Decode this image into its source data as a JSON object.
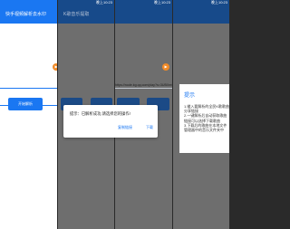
{
  "panel1": {
    "title": "快手视频解析去水印",
    "fab_label": "▶",
    "action_button": "开始解析"
  },
  "panel2": {
    "time": "晚上10:23",
    "title": "K歌音乐提取"
  },
  "panel3": {
    "time": "晚上10:23",
    "url": "https://node.kg.qq.com/play?s=3UBXmOTTFTTNrAc5cd",
    "fab_label": "▶"
  },
  "panel4": {
    "time": "晚上10:23"
  },
  "confirm_dialog": {
    "message": "提示：已解析成功,请选择您的操作!",
    "button_copy": "复制链接",
    "button_download": "下载"
  },
  "tips_dialog": {
    "title": "提示",
    "body": "1.输入要解析的全民K歌歌曲分享链接\n2.一键解析后自动获取歌曲链接可以选择下载歌曲\n3.下载后的歌曲在本地文件管理器中的音乐文件夹中"
  },
  "colors": {
    "primary": "#1a77f2",
    "fab": "#f08a27",
    "overlay": "#6e6e6e"
  }
}
